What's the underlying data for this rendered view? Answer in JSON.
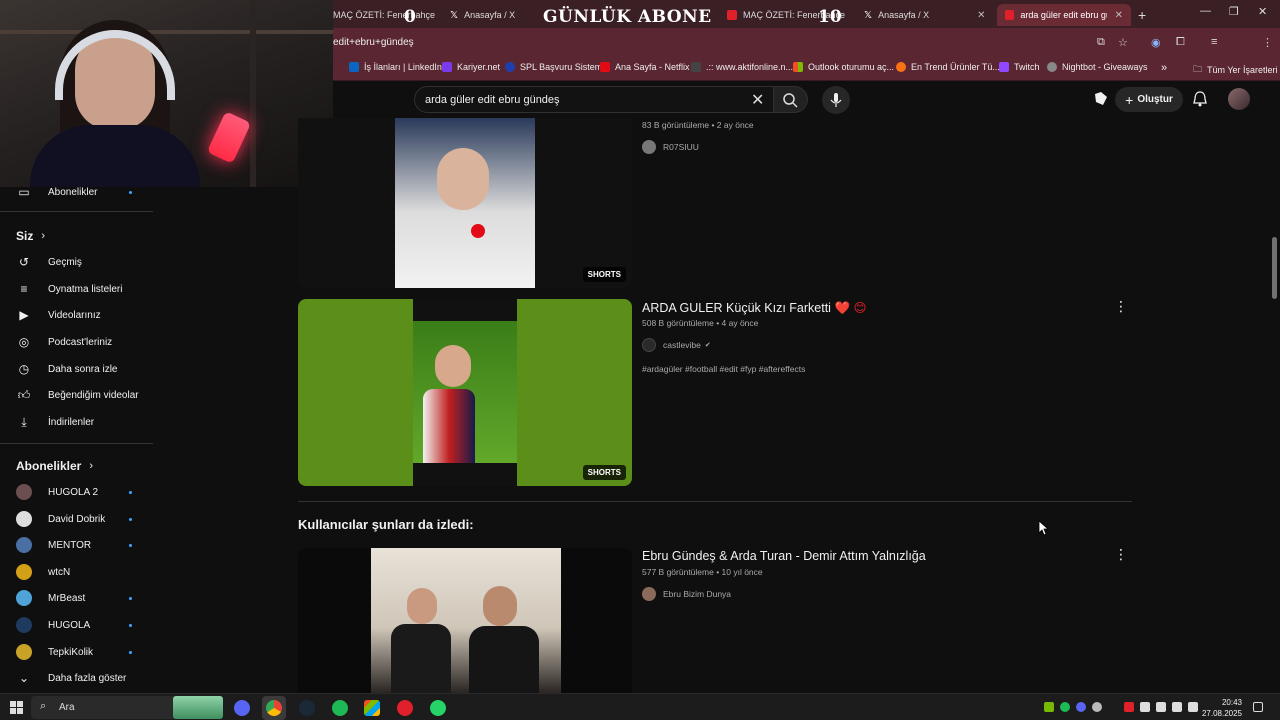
{
  "browser": {
    "tabs": [
      {
        "label": "MAÇ ÖZETİ: Fenerbahçe",
        "favicon": "youtube"
      },
      {
        "label": "Anasayfa / X",
        "favicon": "x"
      },
      {
        "label": "MAÇ ÖZETİ: Fenerbahçe",
        "favicon": "youtube"
      },
      {
        "label": "Anasayfa / X",
        "favicon": "x"
      },
      {
        "label": "arda güler edit ebru günd",
        "favicon": "youtube",
        "active": true
      }
    ],
    "url": "edit+ebru+gündeş",
    "bookmarks": [
      {
        "label": "İş İlanları | LinkedIn",
        "color": "#0a66c2"
      },
      {
        "label": "Kariyer.net",
        "color": "#7c3aed"
      },
      {
        "label": "SPL Başvuru Sistemi",
        "color": "#1e40af"
      },
      {
        "label": "Ana Sayfa - Netflix",
        "color": "#e50914"
      },
      {
        "label": ".:: www.aktifonline.n...",
        "color": "#444"
      },
      {
        "label": "Outlook oturumu aç...",
        "color": "#f59e0b"
      },
      {
        "label": "En Trend Ürünler Tü...",
        "color": "#f97316"
      },
      {
        "label": "Twitch",
        "color": "#9146ff"
      },
      {
        "label": "Nightbot - Giveaways",
        "color": "#888"
      }
    ],
    "bookmarks_more": "»",
    "all_bookmarks": "Tüm Yer İşaretleri"
  },
  "stream_overlay": {
    "banner": "GÜNLÜK ABONE",
    "current": "0",
    "goal": "10"
  },
  "youtube": {
    "search": {
      "value": "arda güler edit ebru gündeş"
    },
    "create_label": "Oluştur",
    "sidebar": {
      "top_item": "Abonelikler",
      "you_header": "Siz",
      "you_items": [
        {
          "label": "Geçmiş",
          "icon": "history-icon"
        },
        {
          "label": "Oynatma listeleri",
          "icon": "playlist-icon"
        },
        {
          "label": "Videolarınız",
          "icon": "your-videos-icon"
        },
        {
          "label": "Podcast'leriniz",
          "icon": "podcast-icon"
        },
        {
          "label": "Daha sonra izle",
          "icon": "watch-later-icon"
        },
        {
          "label": "Beğendiğim videolar",
          "icon": "like-icon"
        },
        {
          "label": "İndirilenler",
          "icon": "download-icon"
        }
      ],
      "subs_header": "Abonelikler",
      "channels": [
        {
          "label": "HUGOLA 2",
          "color": "#6b4e4e",
          "new": true
        },
        {
          "label": "David Dobrik",
          "color": "#ddd",
          "new": true
        },
        {
          "label": "MENTOR",
          "color": "#4a6fa5",
          "new": true
        },
        {
          "label": "wtcN",
          "color": "#d4a017",
          "new": false
        },
        {
          "label": "MrBeast",
          "color": "#4fa3d9",
          "new": true
        },
        {
          "label": "HUGOLA",
          "color": "#1e3a5f",
          "new": true
        },
        {
          "label": "TepkiKolik",
          "color": "#c9a227",
          "new": true
        }
      ],
      "show_more": "Daha fazla göster"
    },
    "results": [
      {
        "meta": "83 B görüntüleme • 2 ay önce",
        "channel": "R07SIUU",
        "badge": "SHORTS"
      },
      {
        "title": "ARDA GULER Küçük Kızı Farketti",
        "title_emoji": "❤️ 😊",
        "meta": "508 B görüntüleme • 4 ay önce",
        "channel": "castlevibe",
        "verified": "✔",
        "tags": "#ardagüler #football #edit #fyp #aftereffects",
        "badge": "SHORTS"
      }
    ],
    "section_title": "Kullanıcılar şunları da izledi:",
    "related": [
      {
        "title": "Ebru Gündeş & Arda Turan - Demir Attım Yalnızlığa",
        "meta": "577 B görüntüleme • 10 yıl önce",
        "channel": "Ebru Bizim Dunya"
      }
    ]
  },
  "taskbar": {
    "search_label": "Ara",
    "time": "20:43",
    "date": "27.08.2025"
  }
}
